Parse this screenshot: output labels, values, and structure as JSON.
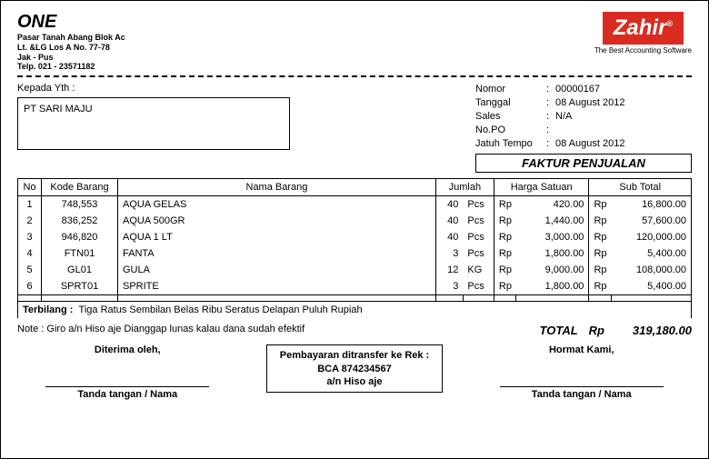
{
  "company": {
    "name": "ONE",
    "addr1": "Pasar Tanah Abang Blok Ac",
    "addr2": "Lt. &LG Los A No. 77-78",
    "addr3": "Jak - Pus",
    "tel": "Telp. 021 - 23571182"
  },
  "logo": {
    "text": "Zahir",
    "tag": "The Best Accounting Software"
  },
  "kepada_label": "Kepada Yth :",
  "customer": "PT SARI MAJU",
  "meta": {
    "nomor_label": "Nomor",
    "nomor": "00000167",
    "tanggal_label": "Tanggal",
    "tanggal": "08 August 2012",
    "sales_label": "Sales",
    "sales": "N/A",
    "nopo_label": "No.PO",
    "nopo": "",
    "jt_label": "Jatuh Tempo",
    "jt": "08 August 2012"
  },
  "title": "FAKTUR PENJUALAN",
  "cols": {
    "no": "No",
    "kode": "Kode Barang",
    "nama": "Nama Barang",
    "jumlah": "Jumlah",
    "harga": "Harga Satuan",
    "sub": "Sub Total"
  },
  "rows": [
    {
      "no": "1",
      "kode": "748,553",
      "nama": "AQUA GELAS",
      "qty": "40",
      "unit": "Pcs",
      "cur": "Rp",
      "harga": "420.00",
      "cur2": "Rp",
      "sub": "16,800.00"
    },
    {
      "no": "2",
      "kode": "836,252",
      "nama": "AQUA 500GR",
      "qty": "40",
      "unit": "Pcs",
      "cur": "Rp",
      "harga": "1,440.00",
      "cur2": "Rp",
      "sub": "57,600.00"
    },
    {
      "no": "3",
      "kode": "946,820",
      "nama": "AQUA 1 LT",
      "qty": "40",
      "unit": "Pcs",
      "cur": "Rp",
      "harga": "3,000.00",
      "cur2": "Rp",
      "sub": "120,000.00"
    },
    {
      "no": "4",
      "kode": "FTN01",
      "nama": "FANTA",
      "qty": "3",
      "unit": "Pcs",
      "cur": "Rp",
      "harga": "1,800.00",
      "cur2": "Rp",
      "sub": "5,400.00"
    },
    {
      "no": "5",
      "kode": "GL01",
      "nama": "GULA",
      "qty": "12",
      "unit": "KG",
      "cur": "Rp",
      "harga": "9,000.00",
      "cur2": "Rp",
      "sub": "108,000.00"
    },
    {
      "no": "6",
      "kode": "SPRT01",
      "nama": "SPRITE",
      "qty": "3",
      "unit": "Pcs",
      "cur": "Rp",
      "harga": "1,800.00",
      "cur2": "Rp",
      "sub": "5,400.00"
    }
  ],
  "terbilang_label": "Terbilang :",
  "terbilang": "Tiga Ratus Sembilan Belas Ribu Seratus Delapan Puluh Rupiah",
  "note": "Note : Giro a/n Hiso aje Dianggap lunas kalau dana sudah efektif",
  "total_label": "TOTAL",
  "total_cur": "Rp",
  "total_val": "319,180.00",
  "sign": {
    "left": "Diterima oleh,",
    "right": "Hormat Kami,",
    "line": "Tanda tangan / Nama"
  },
  "payment": {
    "l1": "Pembayaran ditransfer ke Rek :",
    "l2": "BCA 874234567",
    "l3": "a/n Hiso aje"
  }
}
